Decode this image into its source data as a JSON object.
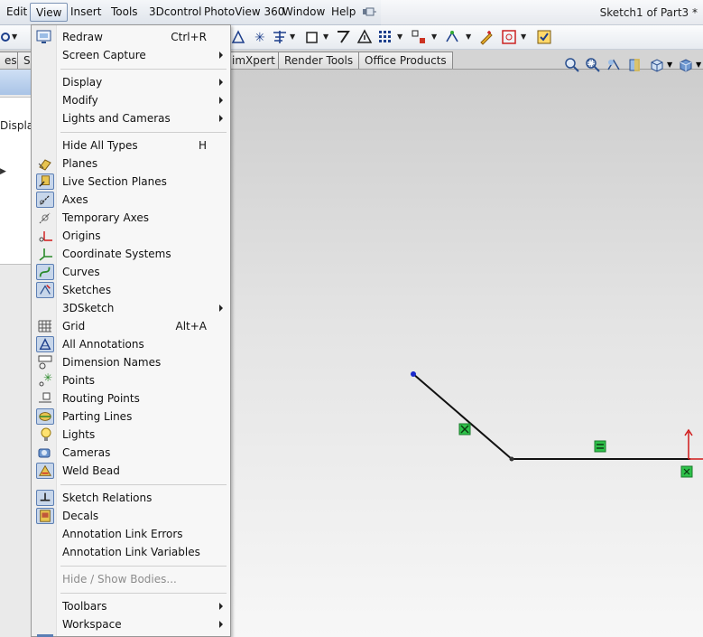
{
  "menubar": {
    "items": [
      "Edit",
      "View",
      "Insert",
      "Tools",
      "3Dcontrol",
      "PhotoView 360",
      "Window",
      "Help"
    ],
    "active": "View"
  },
  "document": {
    "title": "Sketch1 of Part3 *"
  },
  "tabs": [
    "es",
    "S",
    "imXpert",
    "Render Tools",
    "Office Products"
  ],
  "left_panel": {
    "display_text": "Displa"
  },
  "view_menu": {
    "redraw": {
      "label": "Redraw",
      "shortcut": "Ctrl+R"
    },
    "screen_capture": {
      "label": "Screen Capture"
    },
    "display": {
      "label": "Display"
    },
    "modify": {
      "label": "Modify"
    },
    "lights_cameras": {
      "label": "Lights and Cameras"
    },
    "hide_all_types": {
      "label": "Hide All Types",
      "shortcut": "H"
    },
    "planes": {
      "label": "Planes"
    },
    "live_section_planes": {
      "label": "Live Section Planes"
    },
    "axes": {
      "label": "Axes"
    },
    "temporary_axes": {
      "label": "Temporary Axes"
    },
    "origins": {
      "label": "Origins"
    },
    "coordinate_systems": {
      "label": "Coordinate Systems"
    },
    "curves": {
      "label": "Curves"
    },
    "sketches": {
      "label": "Sketches"
    },
    "sketch3d": {
      "label": "3DSketch"
    },
    "grid": {
      "label": "Grid",
      "shortcut": "Alt+A"
    },
    "all_annotations": {
      "label": "All Annotations"
    },
    "dimension_names": {
      "label": "Dimension Names"
    },
    "points": {
      "label": "Points"
    },
    "routing_points": {
      "label": "Routing Points"
    },
    "parting_lines": {
      "label": "Parting Lines"
    },
    "lights": {
      "label": "Lights"
    },
    "cameras": {
      "label": "Cameras"
    },
    "weld_bead": {
      "label": "Weld Bead"
    },
    "sketch_relations": {
      "label": "Sketch Relations"
    },
    "decals": {
      "label": "Decals"
    },
    "annotation_link_errors": {
      "label": "Annotation Link Errors"
    },
    "annotation_link_variables": {
      "label": "Annotation Link Variables"
    },
    "hide_show_bodies": {
      "label": "Hide / Show Bodies..."
    },
    "toolbars": {
      "label": "Toolbars"
    },
    "workspace": {
      "label": "Workspace"
    }
  },
  "colors": {
    "menu_highlight": "#c7d6ea",
    "sketch_line": "#111111",
    "relation_green": "#2ec24a",
    "origin_red": "#d01818",
    "endpoint_blue": "#1a2acc"
  }
}
